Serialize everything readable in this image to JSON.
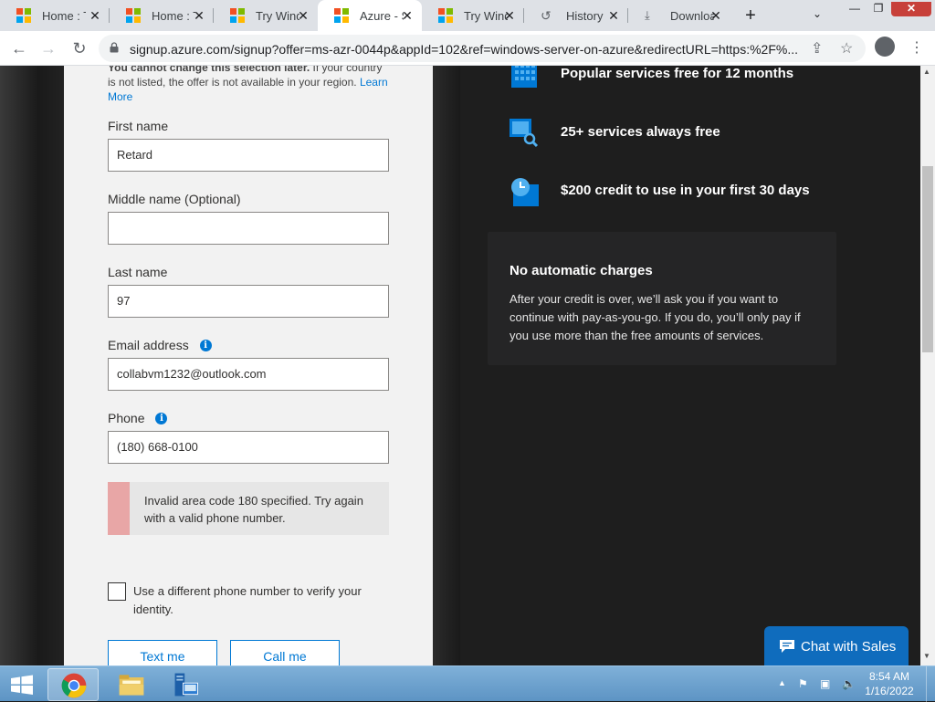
{
  "browser": {
    "tabs": [
      {
        "title": "Home : T",
        "icon": "microsoft-logo"
      },
      {
        "title": "Home : T",
        "icon": "microsoft-logo"
      },
      {
        "title": "Try Wind",
        "icon": "microsoft-logo"
      },
      {
        "title": "Azure - S",
        "icon": "microsoft-logo",
        "active": true
      },
      {
        "title": "Try Wind",
        "icon": "microsoft-logo"
      },
      {
        "title": "History",
        "icon": "history-icon"
      },
      {
        "title": "Downloa",
        "icon": "download-icon"
      }
    ],
    "close_glyph": "✕",
    "new_tab_glyph": "+",
    "url": "signup.azure.com/signup?offer=ms-azr-0044p&appId=102&ref=windows-server-on-azure&redirectURL=https:%2F%..."
  },
  "form": {
    "country_note_bold": "You cannot change this selection later.",
    "country_note_rest": " If your country is not listed, the offer is not available in your region. ",
    "learn_more": "Learn More",
    "first_name_label": "First name",
    "first_name_value": "Retard",
    "middle_name_label": "Middle name (Optional)",
    "middle_name_value": "",
    "last_name_label": "Last name",
    "last_name_value": "97",
    "email_label": "Email address",
    "email_value": "collabvm1232@outlook.com",
    "phone_label": "Phone",
    "phone_value": "(180) 668-0100",
    "error_text": "Invalid area code 180 specified. Try again with a valid phone number.",
    "different_phone_label": "Use a different phone number to verify your identity.",
    "text_me": "Text me",
    "call_me": "Call me"
  },
  "benefits": {
    "items": [
      {
        "text": "Popular services free for 12 months",
        "icon": "grid-calendar-icon"
      },
      {
        "text": "25+ services always free",
        "icon": "monitor-search-icon"
      },
      {
        "text": "$200 credit to use in your first 30 days",
        "icon": "clock-card-icon"
      }
    ],
    "charges_title": "No automatic charges",
    "charges_body": "After your credit is over, we’ll ask you if you want to continue with pay-as-you-go. If you do, you’ll only pay if you use more than the free amounts of services."
  },
  "chat": {
    "label": "Chat with Sales"
  },
  "taskbar": {
    "time": "8:54 AM",
    "date": "1/16/2022"
  },
  "colors": {
    "accent": "#0078d4",
    "error_bar": "#e8a6a6",
    "chat": "#0f6cbd"
  }
}
